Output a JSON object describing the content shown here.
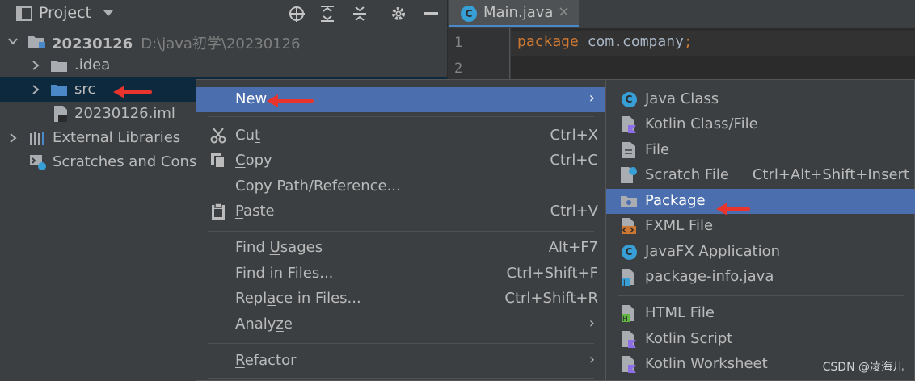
{
  "project_panel": {
    "title": "Project",
    "tree": [
      {
        "label": "20230126",
        "path": "D:\\java初学\\20230126"
      },
      {
        "label": ".idea"
      },
      {
        "label": "src"
      },
      {
        "label": "20230126.iml"
      },
      {
        "label": "External Libraries"
      },
      {
        "label": "Scratches and Conso"
      }
    ]
  },
  "editor": {
    "tab_label": "Main.java",
    "tab_close": "×",
    "line_numbers": [
      "1",
      "2"
    ],
    "code": {
      "keyword": "package",
      "package_name": " com.company",
      "semicolon": ";"
    }
  },
  "context_menu": {
    "items": [
      {
        "pre": "",
        "u": "",
        "post": "New",
        "shortcut": "",
        "submenu": true
      },
      {
        "pre": "Cu",
        "u": "t",
        "post": "",
        "shortcut": "Ctrl+X"
      },
      {
        "pre": "",
        "u": "C",
        "post": "opy",
        "shortcut": "Ctrl+C"
      },
      {
        "pre": "Copy Path/Reference...",
        "u": "",
        "post": "",
        "shortcut": ""
      },
      {
        "pre": "",
        "u": "P",
        "post": "aste",
        "shortcut": "Ctrl+V"
      },
      {
        "pre": "Find ",
        "u": "U",
        "post": "sages",
        "shortcut": "Alt+F7"
      },
      {
        "pre": "Find in Files...",
        "u": "",
        "post": "",
        "shortcut": "Ctrl+Shift+F"
      },
      {
        "pre": "Repl",
        "u": "a",
        "post": "ce in Files...",
        "shortcut": "Ctrl+Shift+R"
      },
      {
        "pre": "Analy",
        "u": "z",
        "post": "e",
        "shortcut": ""
      },
      {
        "pre": "",
        "u": "R",
        "post": "efactor",
        "shortcut": ""
      }
    ],
    "submenu_arrow": "›"
  },
  "new_submenu": {
    "items": [
      {
        "label": "Java Class",
        "shortcut": "",
        "icon": "java-class-icon"
      },
      {
        "label": "Kotlin Class/File",
        "shortcut": "",
        "icon": "kotlin-file-icon"
      },
      {
        "label": "File",
        "shortcut": "",
        "icon": "file-icon"
      },
      {
        "label": "Scratch File",
        "shortcut": "Ctrl+Alt+Shift+Insert",
        "icon": "scratch-file-icon"
      },
      {
        "label": "Package",
        "shortcut": "",
        "icon": "package-icon"
      },
      {
        "label": "FXML File",
        "shortcut": "",
        "icon": "fxml-file-icon"
      },
      {
        "label": "JavaFX Application",
        "shortcut": "",
        "icon": "javafx-application-icon"
      },
      {
        "label": "package-info.java",
        "shortcut": "",
        "icon": "package-info-icon"
      },
      {
        "label": "HTML File",
        "shortcut": "",
        "icon": "html-file-icon"
      },
      {
        "label": "Kotlin Script",
        "shortcut": "",
        "icon": "kotlin-script-icon"
      },
      {
        "label": "Kotlin Worksheet",
        "shortcut": "",
        "icon": "kotlin-worksheet-icon"
      }
    ]
  },
  "watermark": "CSDN @凌海儿",
  "colors": {
    "selection": "#4b6eaf",
    "tree_selection": "#0d293e",
    "annotation_arrow": "#e8342c",
    "keyword": "#cc7832",
    "class_icon": "#389fd6"
  }
}
